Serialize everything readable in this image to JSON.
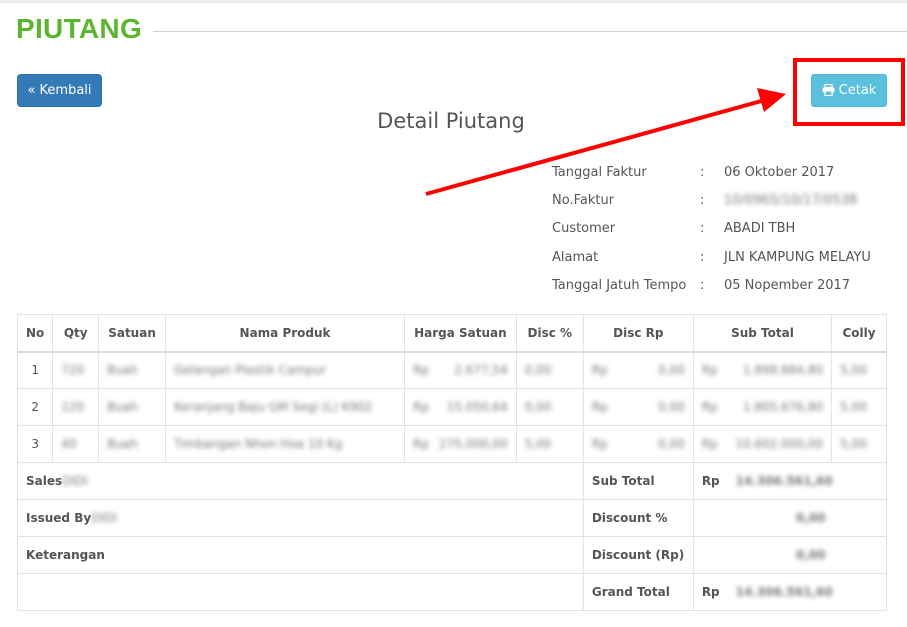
{
  "page_title": "PIUTANG",
  "buttons": {
    "back": "« Kembali",
    "print": "Cetak"
  },
  "detail_title": "Detail Piutang",
  "info": [
    {
      "label": "Tanggal Faktur",
      "value": "06 Oktober 2017"
    },
    {
      "label": "No.Faktur",
      "value": "10/0965/10/17/0538"
    },
    {
      "label": "Customer",
      "value": "ABADI TBH"
    },
    {
      "label": "Alamat",
      "value": "JLN KAMPUNG MELAYU"
    },
    {
      "label": "Tanggal Jatuh Tempo",
      "value": "05 Nopember 2017"
    }
  ],
  "colon": ":",
  "table": {
    "headers": [
      "No",
      "Qty",
      "Satuan",
      "Nama Produk",
      "Harga Satuan",
      "Disc %",
      "Disc Rp",
      "Sub Total",
      "Colly"
    ],
    "rows": [
      {
        "no": "1",
        "qty": "720",
        "satuan": "Buah",
        "nama": "Gelangan Plastik Campur",
        "harga": "2.677,54",
        "disc_pct": "0,00",
        "disc_rp": "0,00",
        "sub_total": "1.898.884,80",
        "colly": "5,00"
      },
      {
        "no": "2",
        "qty": "120",
        "satuan": "Buah",
        "nama": "Keranjang Baju GM Segi (L) K902",
        "harga": "15.050,64",
        "disc_pct": "0,00",
        "disc_rp": "0,00",
        "sub_total": "1.805.676,80",
        "colly": "5,00"
      },
      {
        "no": "3",
        "qty": "40",
        "satuan": "Buah",
        "nama": "Timbangan Nhon Hoa 10 Kg",
        "harga": "275.000,00",
        "disc_pct": "5,00",
        "disc_rp": "0,00",
        "sub_total": "10.602.000,00",
        "colly": "5,00"
      }
    ],
    "currency": "Rp",
    "footer": {
      "sales_label": "Sales",
      "sales_value": "DIDI",
      "issued_label": "Issued By",
      "issued_value": "DIDI",
      "keterangan_label": "Keterangan",
      "sub_total_label": "Sub Total",
      "sub_total_value": "14.306.561,60",
      "discount_pct_label": "Discount %",
      "discount_pct_value": "0,00",
      "discount_rp_label": "Discount (Rp)",
      "discount_rp_value": "0,00",
      "grand_total_label": "Grand Total",
      "grand_total_value": "14.306.561,60"
    }
  },
  "colors": {
    "title_green": "#5cb531",
    "back_button": "#337ab7",
    "print_button": "#5bc0de",
    "annotation_red": "#ff0000"
  }
}
